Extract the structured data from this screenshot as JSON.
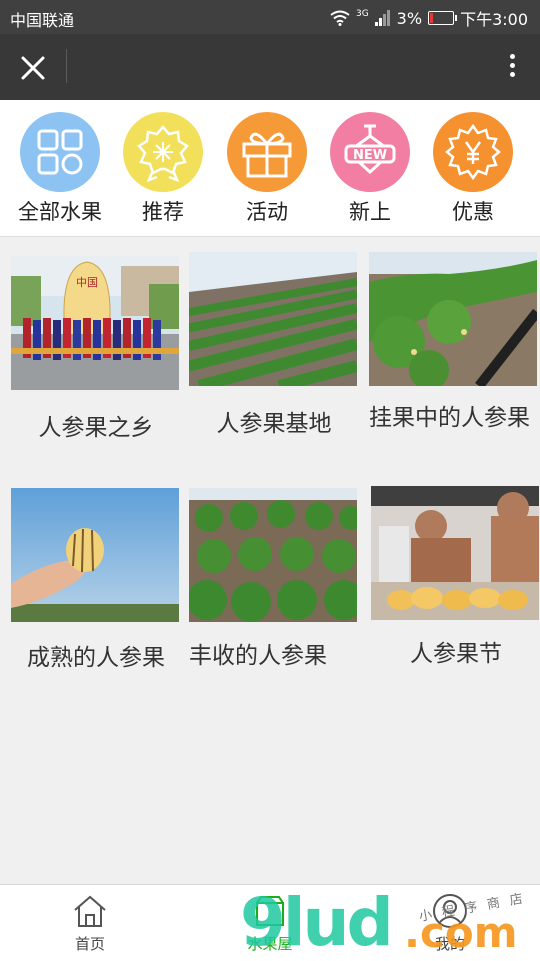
{
  "status_bar": {
    "carrier": "中国联通",
    "network": "3G",
    "battery": "3%",
    "time": "下午3:00"
  },
  "nav": {
    "close_icon": "close-icon",
    "more_icon": "more-vertical-icon"
  },
  "categories": [
    {
      "label": "全部水果",
      "icon": "grid-apps-icon",
      "color": "#8cc3f2"
    },
    {
      "label": "推荐",
      "icon": "badge-star-icon",
      "color": "#f2e05a"
    },
    {
      "label": "活动",
      "icon": "gift-icon",
      "color": "#f59a36"
    },
    {
      "label": "新上",
      "icon": "new-sign-icon",
      "color": "#f27fa3"
    },
    {
      "label": "优惠",
      "icon": "yen-coupon-icon",
      "color": "#f5912f"
    }
  ],
  "products": [
    {
      "title": "人参果之乡"
    },
    {
      "title": "人参果基地"
    },
    {
      "title": "挂果中的人参果"
    },
    {
      "title": "成熟的人参果"
    },
    {
      "title": "丰收的人参果"
    },
    {
      "title": "人参果节"
    }
  ],
  "tabs": [
    {
      "label": "首页",
      "icon": "home-icon"
    },
    {
      "label": "水果屋",
      "icon": "shop-icon"
    },
    {
      "label": "我的",
      "icon": "user-icon"
    }
  ],
  "watermark": {
    "brand": "9lud",
    "suffix": ".com",
    "tagline": "小程序商店"
  }
}
